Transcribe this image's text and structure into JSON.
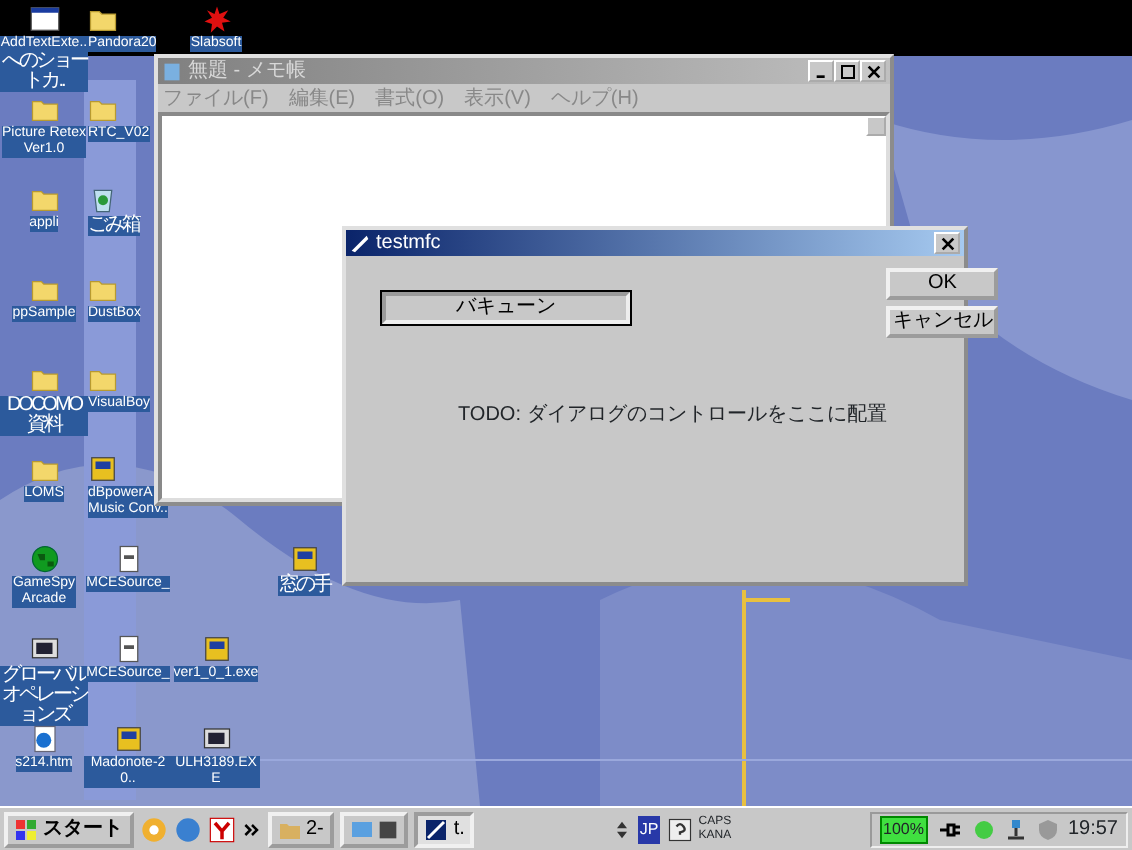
{
  "desktop_icon_columns": [
    [
      {
        "label": "AddTextExte..\nへのショートカ..",
        "kind": "window"
      },
      {
        "label": "Picture Retex\nVer1.0",
        "kind": "folder"
      },
      {
        "label": "appli",
        "kind": "folder"
      },
      {
        "label": "ppSample",
        "kind": "folder"
      },
      {
        "label": "DOCOMO資料",
        "kind": "folder"
      },
      {
        "label": "LOMS",
        "kind": "folder"
      },
      {
        "label": "GameSpy\nArcade",
        "kind": "globe"
      },
      {
        "label": "グローバルオペレーションズ",
        "kind": "monitor"
      },
      {
        "label": "s214.htm",
        "kind": "html"
      }
    ],
    [
      {
        "label": "Pandora20",
        "kind": "folder"
      },
      {
        "label": "RTC_V02",
        "kind": "folder"
      },
      {
        "label": "ごみ箱",
        "kind": "recycle"
      },
      {
        "label": "DustBox",
        "kind": "folder"
      },
      {
        "label": "VisualBoy",
        "kind": "folder"
      },
      {
        "label": "dBpowerA\nMusic Conv..",
        "kind": "app"
      },
      {
        "label": "MCESource_",
        "kind": "doc"
      },
      {
        "label": "MCESource_",
        "kind": "doc"
      },
      {
        "label": "Madonote-20..",
        "kind": "app"
      }
    ],
    [
      {
        "label": "Slabsoft",
        "kind": "splat"
      },
      {
        "label": "ver1_0_1.exe",
        "kind": "app"
      },
      {
        "label": "ULH3189.EXE",
        "kind": "monitor"
      }
    ],
    [
      {
        "label": "窓の手",
        "kind": "app"
      }
    ]
  ],
  "notepad": {
    "title": "無題 - メモ帳",
    "menu": [
      "ファイル(F)",
      "編集(E)",
      "書式(O)",
      "表示(V)",
      "ヘルプ(H)"
    ]
  },
  "dialog": {
    "title": "testmfc",
    "action_button": "バキューン",
    "text": "TODO: ダイアログのコントロールをここに配置",
    "buttons": [
      "OK",
      "キャンセル"
    ]
  },
  "taskbar": {
    "start": "スタート",
    "tasks": [
      {
        "label": "2-",
        "selected": false
      },
      {
        "label": "t.",
        "selected": true
      }
    ],
    "language": "JP",
    "caps": "CAPS",
    "kana": "KANA",
    "battery": "100%",
    "clock": "19:57"
  }
}
